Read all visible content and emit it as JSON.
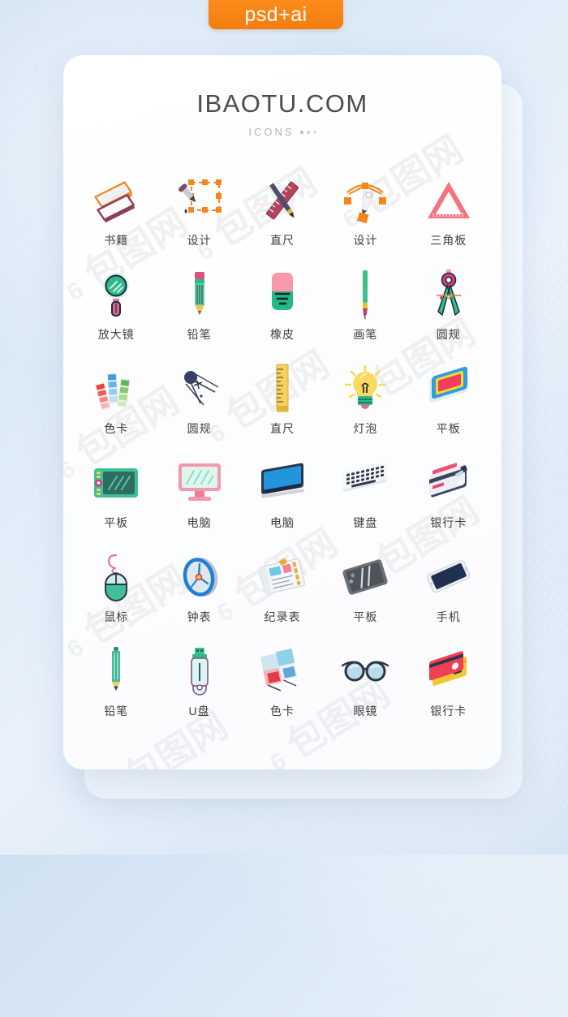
{
  "badge": {
    "label": "psd+ai"
  },
  "header": {
    "title": "IBAOTU.COM",
    "subtitle": "ICONS"
  },
  "watermark": {
    "text": "包图网",
    "mark": "6"
  },
  "colors": {
    "badge_orange": "#f57c10",
    "background_blue": "#dceaf7",
    "card_white": "#ffffff",
    "title_gray": "#4c4c4c",
    "subtitle_gray": "#b4b4b4",
    "caption_gray": "#3f3f3f",
    "watermark_gray": "#e2e4e7"
  },
  "grid": {
    "columns": 5,
    "rows": 6,
    "items": [
      {
        "label": "书籍",
        "icon": "books-icon"
      },
      {
        "label": "设计",
        "icon": "eyedropper-design-icon"
      },
      {
        "label": "直尺",
        "icon": "ruler-pen-icon"
      },
      {
        "label": "设计",
        "icon": "pen-tool-icon"
      },
      {
        "label": "三角板",
        "icon": "triangle-ruler-icon"
      },
      {
        "label": "放大镜",
        "icon": "magnifier-icon"
      },
      {
        "label": "铅笔",
        "icon": "pencil-icon"
      },
      {
        "label": "橡皮",
        "icon": "eraser-icon"
      },
      {
        "label": "画笔",
        "icon": "paintbrush-icon"
      },
      {
        "label": "圆规",
        "icon": "compass-icon"
      },
      {
        "label": "色卡",
        "icon": "color-swatch-icon"
      },
      {
        "label": "圆规",
        "icon": "drafting-compass-icon"
      },
      {
        "label": "直尺",
        "icon": "ruler-yellow-icon"
      },
      {
        "label": "灯泡",
        "icon": "lightbulb-icon"
      },
      {
        "label": "平板",
        "icon": "tablet-colorful-icon"
      },
      {
        "label": "平板",
        "icon": "drawing-tablet-icon"
      },
      {
        "label": "电脑",
        "icon": "monitor-pink-icon"
      },
      {
        "label": "电脑",
        "icon": "imac-blue-icon"
      },
      {
        "label": "键盘",
        "icon": "keyboard-icon"
      },
      {
        "label": "银行卡",
        "icon": "bank-cards-navy-icon"
      },
      {
        "label": "鼠标",
        "icon": "mouse-icon"
      },
      {
        "label": "钟表",
        "icon": "clock-icon"
      },
      {
        "label": "纪录表",
        "icon": "notebook-record-icon"
      },
      {
        "label": "平板",
        "icon": "tablet-gray-icon"
      },
      {
        "label": "手机",
        "icon": "smartphone-icon"
      },
      {
        "label": "铅笔",
        "icon": "pencil-green-icon"
      },
      {
        "label": "U盘",
        "icon": "usb-drive-icon"
      },
      {
        "label": "色卡",
        "icon": "color-fan-icon"
      },
      {
        "label": "眼镜",
        "icon": "glasses-icon"
      },
      {
        "label": "银行卡",
        "icon": "bank-cards-red-icon"
      }
    ]
  }
}
